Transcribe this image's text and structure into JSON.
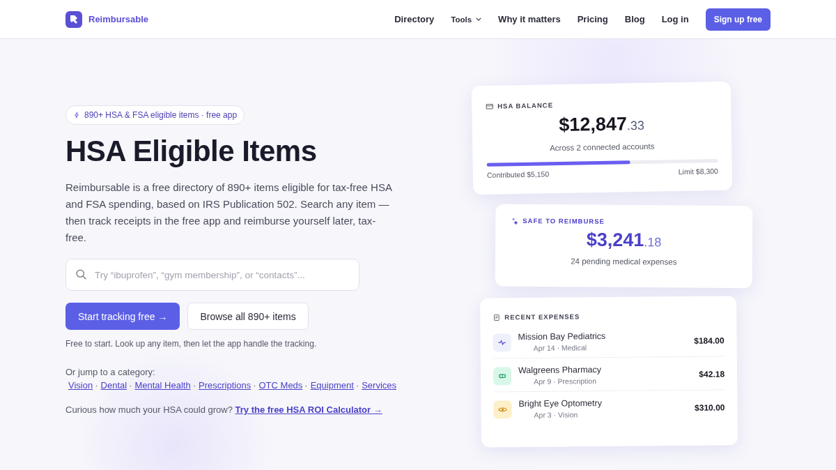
{
  "brand": {
    "name": "Reimbursable"
  },
  "nav": [
    {
      "label": "Directory",
      "kind": "link"
    },
    {
      "label": "Tools",
      "kind": "dropdown"
    },
    {
      "label": "Why it matters",
      "kind": "link"
    },
    {
      "label": "Pricing",
      "kind": "link"
    },
    {
      "label": "Blog",
      "kind": "link"
    },
    {
      "label": "Log in",
      "kind": "link"
    },
    {
      "label": "Sign up free",
      "kind": "button"
    }
  ],
  "hero": {
    "badge": "890+ HSA & FSA eligible items · free app",
    "title": "HSA Eligible Items",
    "description": "Reimbursable is a free directory of 890+ items eligible for tax-free HSA and FSA spending, based on IRS Publication 502. Search any item — then track receipts in the free app and reimburse yourself later, tax-free.",
    "search": {
      "placeholder": "Try “ibuprofen”, “gym membership”, or “contacts”..."
    },
    "primary_button": "Start tracking free →",
    "secondary_button": "Browse all 890+ items",
    "note": "Free to start. Look up any item, then let the app handle the tracking.",
    "categories_label": "Or jump to a category:",
    "separator": "·",
    "categories": [
      "Vision",
      "Dental",
      "Mental Health",
      "Prescriptions",
      "OTC Meds",
      "Equipment",
      "Services"
    ],
    "roi_text": "Curious how much your HSA could grow?",
    "roi_link": "Try the free HSA ROI Calculator →"
  },
  "balance_card": {
    "label": "HSA BALANCE",
    "amount": "$12,847",
    "cents": ".33",
    "subtitle": "Across 2 connected accounts",
    "level": 0.62,
    "contributed": "Contributed $5,150",
    "limit": "Limit $8,300"
  },
  "reimburse_card": {
    "label": "SAFE TO REIMBURSE",
    "amount": "$3,241",
    "cents": ".18",
    "subtitle": "24 pending medical expenses"
  },
  "expenses_card": {
    "label": "RECENT EXPENSES",
    "items": [
      {
        "name": "Mission Bay Pediatrics",
        "meta": "Apr 14 · Medical",
        "amount": "$184.00",
        "kind": "pulse",
        "color": "#eef0fb"
      },
      {
        "name": "Walgreens Pharmacy",
        "meta": "Apr 9 · Prescription",
        "amount": "$42.18",
        "kind": "pill",
        "color": "#d9f7e8"
      },
      {
        "name": "Bright Eye Optometry",
        "meta": "Apr 3 · Vision",
        "amount": "$310.00",
        "kind": "eye",
        "color": "#fdf0c8"
      }
    ]
  }
}
